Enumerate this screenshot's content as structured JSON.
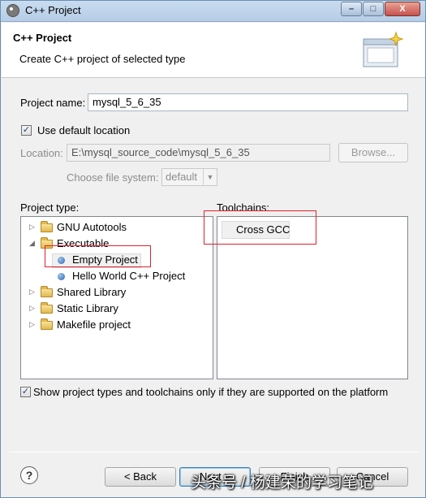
{
  "window": {
    "title": "C++ Project",
    "minimize": "–",
    "maximize": "□",
    "close": "X"
  },
  "banner": {
    "title": "C++ Project",
    "description": "Create C++ project of selected type"
  },
  "form": {
    "project_name_label": "Project name:",
    "project_name_value": "mysql_5_6_35",
    "use_default_location_label": "Use default location",
    "use_default_location_checked": true,
    "location_label": "Location:",
    "location_value": "E:\\mysql_source_code\\mysql_5_6_35",
    "browse_label": "Browse...",
    "filesystem_label": "Choose file system:",
    "filesystem_value": "default"
  },
  "project_type": {
    "label": "Project type:",
    "items": [
      {
        "label": "GNU Autotools",
        "kind": "folder",
        "expanded": false
      },
      {
        "label": "Executable",
        "kind": "folder",
        "expanded": true
      },
      {
        "label": "Empty Project",
        "kind": "leaf",
        "selected": true
      },
      {
        "label": "Hello World C++ Project",
        "kind": "leaf",
        "selected": false
      },
      {
        "label": "Shared Library",
        "kind": "folder",
        "expanded": false
      },
      {
        "label": "Static Library",
        "kind": "folder",
        "expanded": false
      },
      {
        "label": "Makefile project",
        "kind": "folder",
        "expanded": false
      }
    ]
  },
  "toolchains": {
    "label": "Toolchains:",
    "items": [
      "Cross GCC"
    ]
  },
  "show_supported": {
    "label": "Show project types and toolchains only if they are supported on the platform",
    "checked": true
  },
  "buttons": {
    "back": "< Back",
    "next": "Next >",
    "finish": "Finish",
    "cancel": "Cancel"
  },
  "help_icon": "?",
  "watermark": "头条号 / 杨建荣的学习笔记",
  "colors": {
    "highlight_red": "#e02030",
    "titlebar": "#b6cde6",
    "default_button_border": "#3c7fb1"
  }
}
